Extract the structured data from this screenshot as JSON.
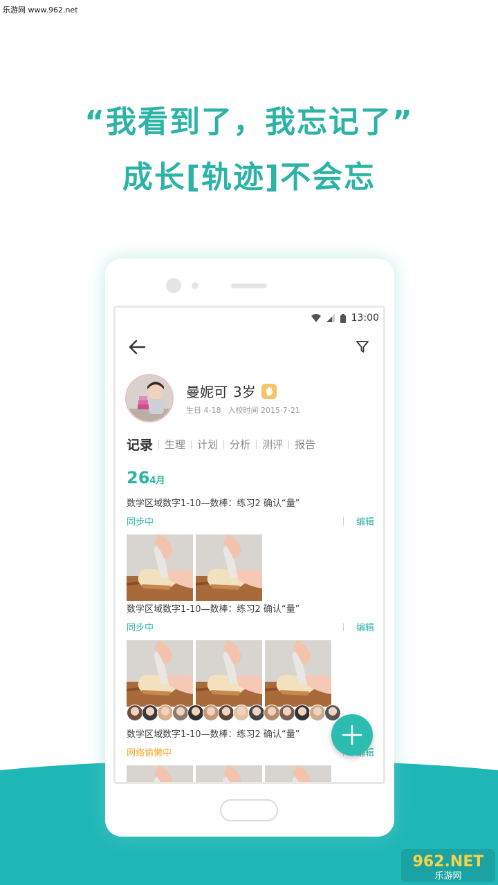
{
  "watermark_top": "乐游网 www.962.net",
  "headline": {
    "line1": "“我看到了，我忘记了”",
    "line2": "成长[轨迹]不会忘"
  },
  "status_bar": {
    "time": "13:00"
  },
  "profile": {
    "name": "曼妮可",
    "age": "3岁",
    "birthday": "生日 4-18",
    "enroll": "入校时间 2015-7-21"
  },
  "tabs": [
    "记录",
    "生理",
    "计划",
    "分析",
    "测评",
    "报告"
  ],
  "date": {
    "day": "26",
    "month": "4月"
  },
  "records": [
    {
      "title": "数学区域数字1-10—数棒：练习2 确认“量”",
      "status": "同步中",
      "edit": "编辑"
    },
    {
      "title": "数学区域数字1-10—数棒：练习2 确认“量”",
      "status": "同步中",
      "edit": "编辑"
    },
    {
      "title": "数学区域数字1-10—数棒：练习2 确认“量”",
      "status": "网络偷懒中",
      "edit": "编辑"
    }
  ],
  "icons": {
    "back": "back-arrow-icon",
    "filter": "filter-icon",
    "fab": "plus-icon",
    "badge": "hand-icon"
  },
  "colors": {
    "accent": "#2bb3a6",
    "warning": "#f5a623",
    "fab": "#2cbdb0"
  },
  "logo": {
    "text1": "962.NET",
    "text2": "乐游网"
  }
}
